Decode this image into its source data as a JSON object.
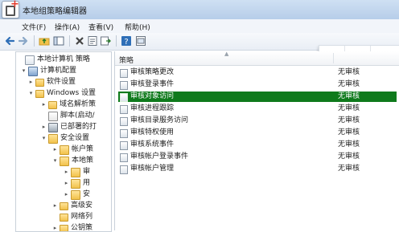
{
  "window": {
    "title": "本地组策略编辑器"
  },
  "menu": [
    {
      "label": "文件(F)"
    },
    {
      "label": "操作(A)"
    },
    {
      "label": "查看(V)"
    },
    {
      "label": "帮助(H)"
    }
  ],
  "tree": [
    {
      "label": "本地计算机 策略",
      "icon": "policy-icon",
      "toggle": ""
    },
    {
      "label": "计算机配置",
      "icon": "computer-icon",
      "toggle": "▾"
    },
    {
      "label": "软件设置",
      "icon": "folder-icon",
      "toggle": "▸"
    },
    {
      "label": "Windows 设置",
      "icon": "folder-icon",
      "toggle": "▾"
    },
    {
      "label": "域名解析策",
      "icon": "folder-icon",
      "toggle": "▸"
    },
    {
      "label": "脚本(启动/",
      "icon": "script-icon",
      "toggle": ""
    },
    {
      "label": "已部署的打",
      "icon": "printer-icon",
      "toggle": "▸"
    },
    {
      "label": "安全设置",
      "icon": "lock-icon",
      "toggle": "▾"
    },
    {
      "label": "帐户策",
      "icon": "lock-icon",
      "toggle": "▸"
    },
    {
      "label": "本地策",
      "icon": "lock-icon",
      "toggle": "▾"
    },
    {
      "label": "审",
      "icon": "lock-icon",
      "toggle": "▸"
    },
    {
      "label": "用",
      "icon": "lock-icon",
      "toggle": "▸"
    },
    {
      "label": "安",
      "icon": "lock-icon",
      "toggle": "▸"
    },
    {
      "label": "高级安",
      "icon": "folder-icon",
      "toggle": "▸"
    },
    {
      "label": "网络列",
      "icon": "folder-icon",
      "toggle": ""
    },
    {
      "label": "公钥策",
      "icon": "folder-icon",
      "toggle": "▸"
    }
  ],
  "list": {
    "columns": {
      "policy": "策略",
      "setting": ""
    },
    "rows": [
      {
        "label": "审核策略更改",
        "value": "无审核",
        "selected": false
      },
      {
        "label": "审核登录事件",
        "value": "无审核",
        "selected": false
      },
      {
        "label": "审核对象访问",
        "value": "无审核",
        "selected": true
      },
      {
        "label": "审核进程跟踪",
        "value": "无审核",
        "selected": false
      },
      {
        "label": "审核目录服务访问",
        "value": "无审核",
        "selected": false
      },
      {
        "label": "审核特权使用",
        "value": "无审核",
        "selected": false
      },
      {
        "label": "审核系统事件",
        "value": "无审核",
        "selected": false
      },
      {
        "label": "审核帐户登录事件",
        "value": "无审核",
        "selected": false
      },
      {
        "label": "审核帐户管理",
        "value": "无审核",
        "selected": false
      }
    ]
  },
  "colors": {
    "selection": "#0f7a1c",
    "float_icon": "#3aa35b"
  }
}
